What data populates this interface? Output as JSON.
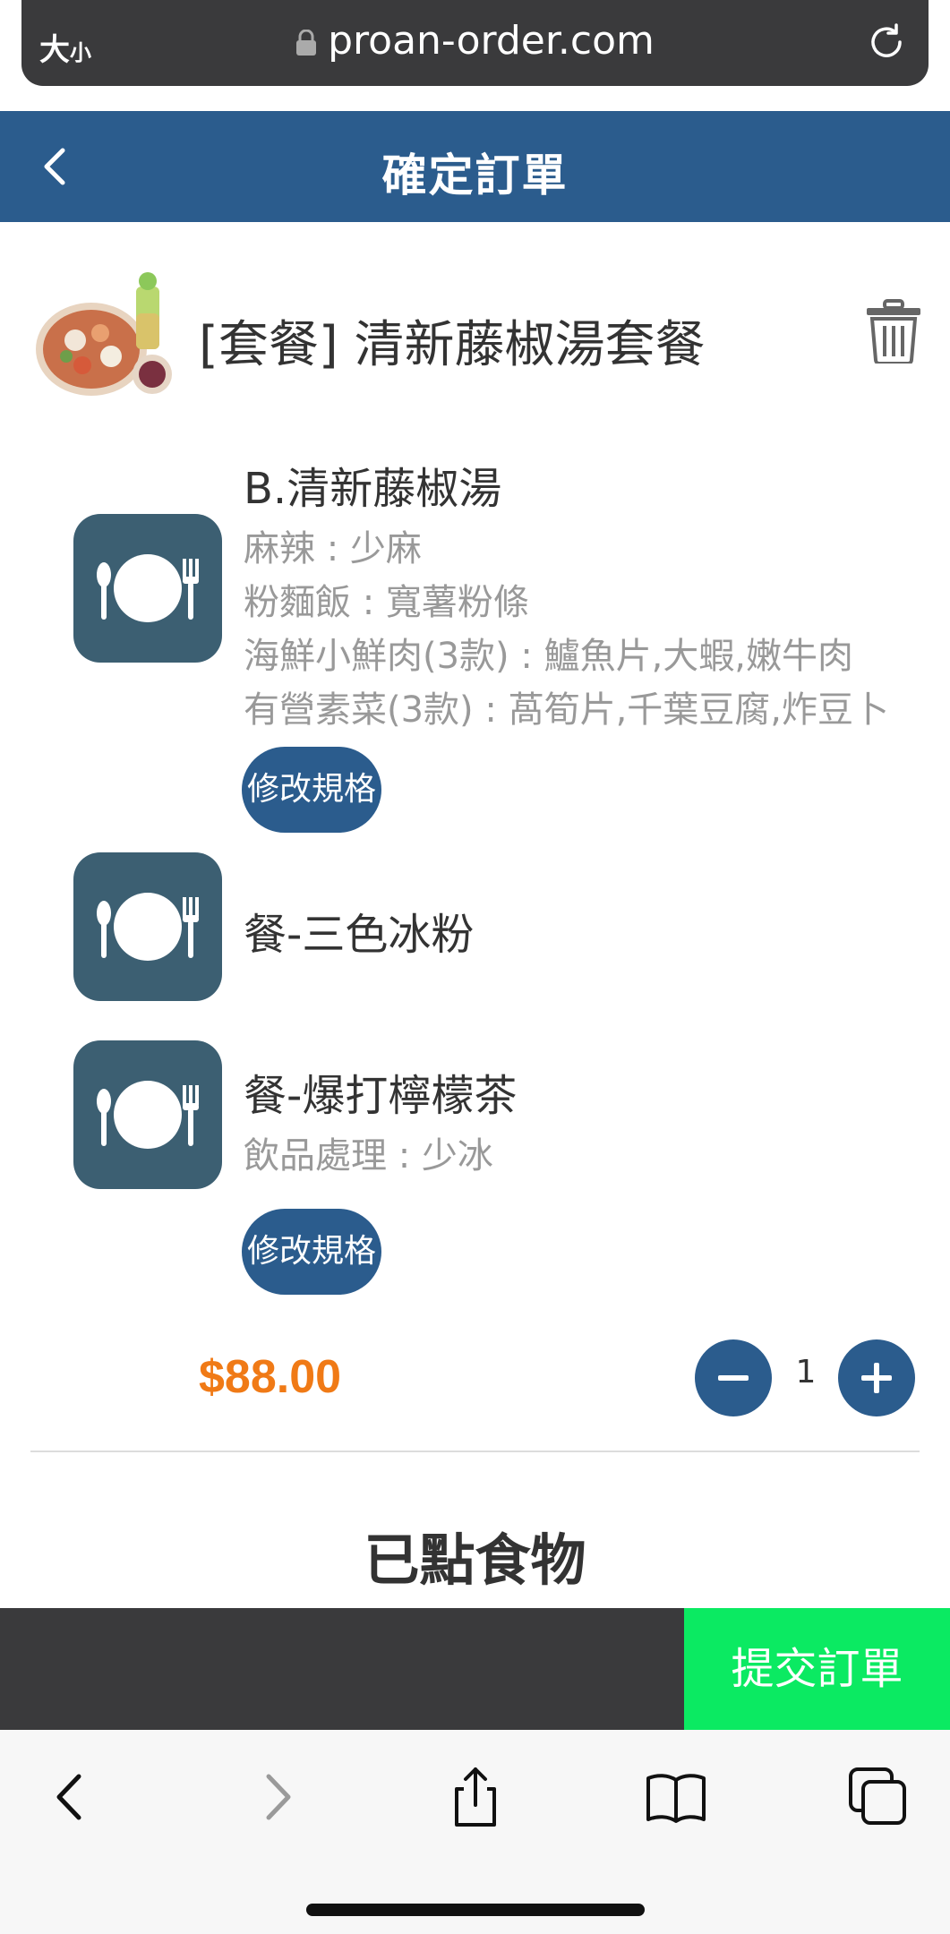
{
  "browser": {
    "text_size_label": "大",
    "text_size_label_small": "小",
    "url": "proan-order.com"
  },
  "header": {
    "title": "確定訂單"
  },
  "combo": {
    "name": "[套餐] 清新藤椒湯套餐",
    "items": [
      {
        "title": "B.清新藤椒湯",
        "options": [
          "麻辣 : 少麻",
          "粉麵飯 : 寬薯粉條",
          "海鮮小鮮肉(3款) : 鱸魚片,大蝦,嫩牛肉",
          "有營素菜(3款) : 萵筍片,千葉豆腐,炸豆卜"
        ],
        "button": "修改規格"
      },
      {
        "title": "餐-三色冰粉"
      },
      {
        "title": "餐-爆打檸檬茶",
        "options": [
          "飲品處理 : 少冰"
        ],
        "button": "修改規格"
      }
    ],
    "price": "$88.00",
    "quantity": "1"
  },
  "section_title": "已點食物",
  "footer": {
    "submit_label": "提交訂單"
  },
  "colors": {
    "header": "#2b5c8d",
    "submit": "#0bea62",
    "price": "#f07a16",
    "plate": "#3c5f72"
  }
}
